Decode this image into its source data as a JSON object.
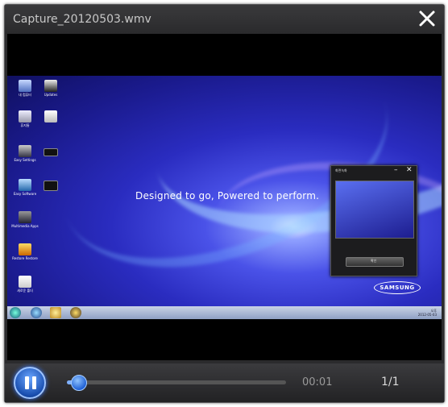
{
  "window": {
    "title": "Capture_20120503.wmv"
  },
  "video": {
    "tagline": "Designed to go, Powered to perform.",
    "brand": "SAMSUNG",
    "desktop_icons": [
      {
        "label": "내 컴퓨터"
      },
      {
        "label": "Updates"
      },
      {
        "label": "휴지통"
      },
      {
        "label": ""
      },
      {
        "label": "Easy Settings"
      },
      {
        "label": ""
      },
      {
        "label": "Easy Software"
      },
      {
        "label": ""
      },
      {
        "label": "Multimedia Apps"
      },
      {
        "label": "Restore Restore"
      },
      {
        "label": "새로운 폴더"
      }
    ],
    "mini_window": {
      "title": "화면녹화",
      "button_label": "확인"
    },
    "tray_time": "오후",
    "tray_date": "2012-05-03"
  },
  "player": {
    "time": "00:01",
    "page_count": "1/1",
    "progress": 0.05
  },
  "colors": {
    "accent": "#2162d6",
    "background": "#2b2b2d"
  }
}
